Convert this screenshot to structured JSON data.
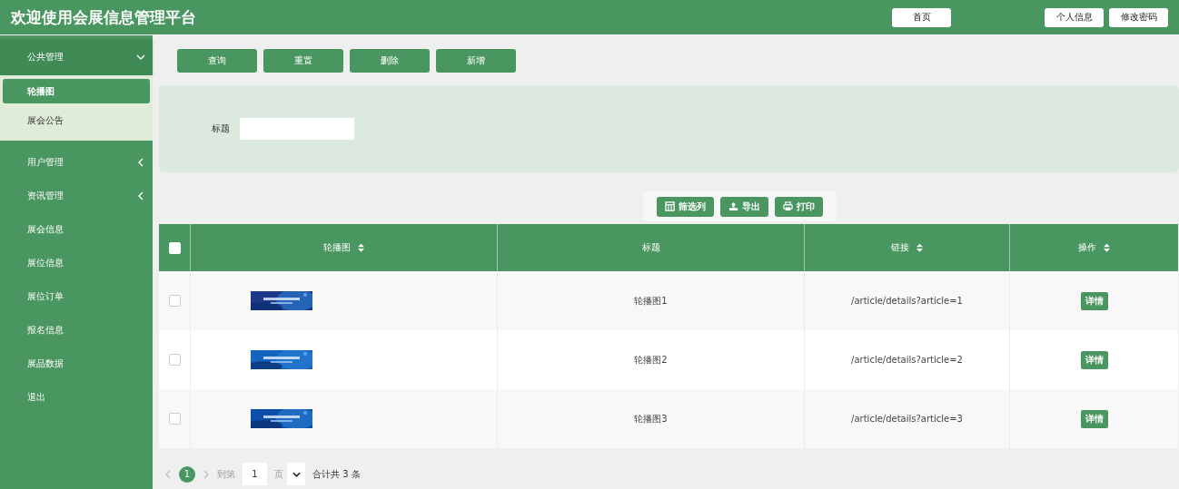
{
  "header": {
    "title": "欢迎使用会展信息管理平台",
    "home_button": "首页",
    "user_buttons": [
      "个人信息",
      "修改密码"
    ]
  },
  "sidebar": {
    "items": [
      {
        "label": "公共管理",
        "expandable": true,
        "expanded": true,
        "children": [
          {
            "label": "轮播图",
            "selected": true
          },
          {
            "label": "展会公告",
            "selected": false
          }
        ]
      },
      {
        "label": "用户管理",
        "expandable": true,
        "expanded": false
      },
      {
        "label": "资讯管理",
        "expandable": true,
        "expanded": false
      },
      {
        "label": "展会信息",
        "expandable": false,
        "expanded": false
      },
      {
        "label": "展位信息",
        "expandable": false,
        "expanded": false
      },
      {
        "label": "展位订单",
        "expandable": false,
        "expanded": false
      },
      {
        "label": "报名信息",
        "expandable": false,
        "expanded": false
      },
      {
        "label": "展品数据",
        "expandable": false,
        "expanded": false
      },
      {
        "label": "退出",
        "expandable": false,
        "expanded": false
      }
    ]
  },
  "actions": [
    "查询",
    "重置",
    "删除",
    "新增"
  ],
  "search": {
    "label": "标题"
  },
  "tools": [
    {
      "kind": "columns",
      "label": "筛选列"
    },
    {
      "kind": "export",
      "label": "导出"
    },
    {
      "kind": "print",
      "label": "打印"
    }
  ],
  "table": {
    "all_checked": false,
    "columns": [
      {
        "label": "轮播图",
        "sortable": true
      },
      {
        "label": "标题",
        "sortable": false
      },
      {
        "label": "链接",
        "sortable": true
      },
      {
        "label": "操作",
        "sortable": true
      }
    ],
    "rows": [
      {
        "title": "轮播图1",
        "link": "/article/details?article=1",
        "action": "详情",
        "selected": false
      },
      {
        "title": "轮播图2",
        "link": "/article/details?article=2",
        "action": "详情",
        "selected": false
      },
      {
        "title": "轮播图3",
        "link": "/article/details?article=3",
        "action": "详情",
        "selected": false
      }
    ]
  },
  "pagination": {
    "pages": [
      {
        "label": "1",
        "selected": true
      }
    ],
    "goto_label": "到第",
    "goto_value": "1",
    "page_unit": "页",
    "total": "合计共 3 条"
  }
}
